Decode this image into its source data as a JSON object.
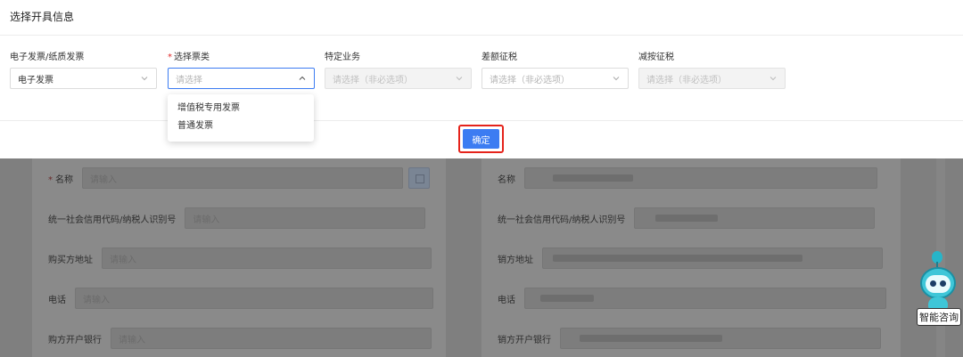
{
  "dialog": {
    "title": "选择开具信息",
    "confirm_label": "确定"
  },
  "fields": [
    {
      "label": "电子发票/纸质发票",
      "required": false,
      "value": "电子发票",
      "state": "normal"
    },
    {
      "label": "选择票类",
      "required": true,
      "placeholder": "请选择",
      "state": "open"
    },
    {
      "label": "特定业务",
      "required": false,
      "placeholder": "请选择（非必选项）",
      "state": "disabled"
    },
    {
      "label": "差额征税",
      "required": false,
      "placeholder": "请选择（非必选项）",
      "state": "normal"
    },
    {
      "label": "减按征税",
      "required": false,
      "placeholder": "请选择（非必选项）",
      "state": "disabled"
    }
  ],
  "required_mark": "*",
  "dropdown": {
    "options": [
      "增值税专用发票",
      "普通发票"
    ]
  },
  "background_form": {
    "buyer": {
      "name_label": "名称",
      "name_placeholder": "请输入",
      "tax_id_label": "统一社会信用代码/纳税人识别号",
      "tax_id_placeholder": "请输入",
      "address_label": "购买方地址",
      "address_placeholder": "请输入",
      "phone_label": "电话",
      "phone_placeholder": "请输入",
      "bank_label": "购方开户银行",
      "bank_placeholder": "请输入"
    },
    "seller": {
      "name_label": "名称",
      "tax_id_label": "统一社会信用代码/纳税人识别号",
      "address_label": "销方地址",
      "phone_label": "电话",
      "bank_label": "销方开户银行"
    }
  },
  "assistant": {
    "label": "智能咨询",
    "icon": "robot-icon"
  },
  "colors": {
    "primary": "#3c7cf2",
    "required": "#e02b2b",
    "highlight_border": "#e5231b"
  }
}
